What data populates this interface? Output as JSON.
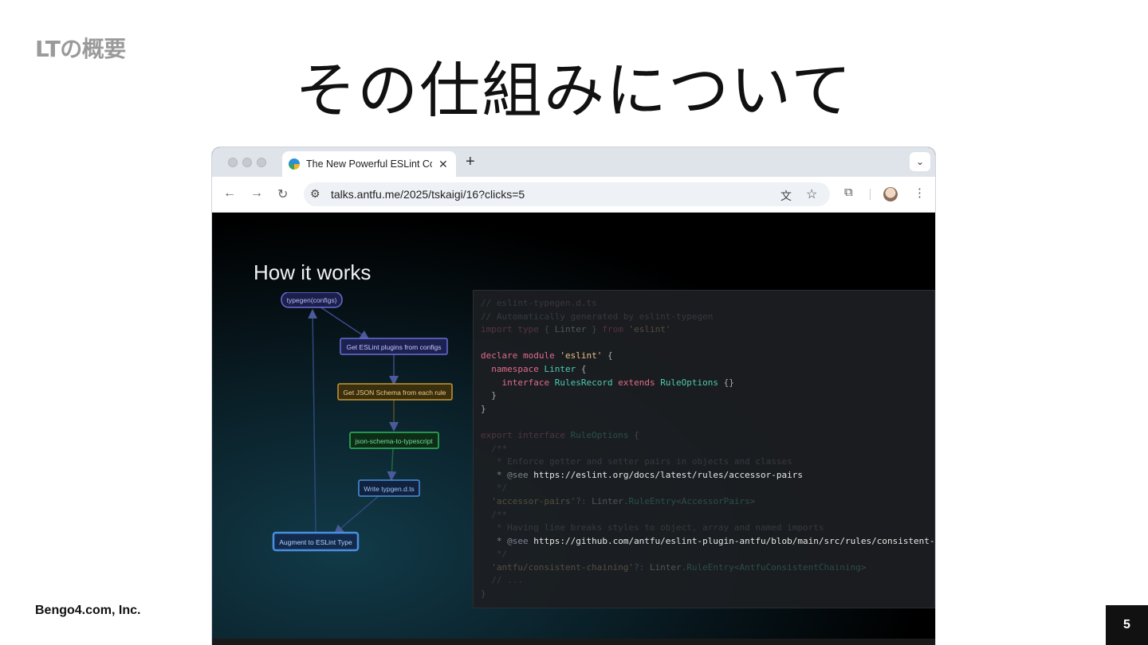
{
  "slide": {
    "section_label": "LTの概要",
    "title": "その仕組みについて",
    "company": "Bengo4.com, Inc.",
    "page_number": "5"
  },
  "browser": {
    "tab_title": "The New Powerful ESLint Con",
    "tab_close": "✕",
    "new_tab": "+",
    "tab_menu": "⌄",
    "back": "←",
    "forward": "→",
    "reload": "↻",
    "site_info": "⚙",
    "url": "talks.antfu.me/2025/tskaigi/16?clicks=5",
    "translate_icon": "文",
    "bookmark_icon": "☆",
    "extensions_icon": "⧉",
    "menu_icon": "⋮"
  },
  "presentation": {
    "heading": "How it works",
    "flow_nodes": [
      {
        "label": "typegen(configs)",
        "color": "#7b7fe0"
      },
      {
        "label": "Get ESLint plugins from configs",
        "color": "#7b7fe0"
      },
      {
        "label": "Get JSON Schema from each rule",
        "color": "#d6a62a"
      },
      {
        "label": "json-schema-to-typescript",
        "color": "#2fb85a"
      },
      {
        "label": "Write typgen.d.ts",
        "color": "#4a8fe0"
      },
      {
        "label": "Augment to ESLint Type",
        "color": "#4a8fe0"
      }
    ],
    "code_lines": [
      {
        "dim": true,
        "tokens": [
          [
            "// eslint-typegen.d.ts",
            "cmt"
          ]
        ]
      },
      {
        "dim": true,
        "tokens": [
          [
            "// Automatically generated by eslint-typegen",
            "cmt"
          ]
        ]
      },
      {
        "dim": true,
        "tokens": [
          [
            "import ",
            "kw"
          ],
          [
            "type ",
            "kw"
          ],
          [
            "{ ",
            "punc"
          ],
          [
            "Linter",
            "txt"
          ],
          [
            " } ",
            "punc"
          ],
          [
            "from ",
            "kw"
          ],
          [
            "'eslint'",
            "str"
          ]
        ]
      },
      {
        "dim": false,
        "tokens": [
          [
            "",
            "txt"
          ]
        ]
      },
      {
        "dim": false,
        "tokens": [
          [
            "declare ",
            "kw"
          ],
          [
            "module ",
            "kw"
          ],
          [
            "'eslint'",
            "str"
          ],
          [
            " {",
            "punc"
          ]
        ]
      },
      {
        "dim": false,
        "tokens": [
          [
            "  namespace ",
            "kw"
          ],
          [
            "Linter",
            "type"
          ],
          [
            " {",
            "punc"
          ]
        ]
      },
      {
        "dim": false,
        "tokens": [
          [
            "    interface ",
            "kw"
          ],
          [
            "RulesRecord ",
            "type"
          ],
          [
            "extends ",
            "kw"
          ],
          [
            "RuleOptions ",
            "type"
          ],
          [
            "{}",
            "punc"
          ]
        ]
      },
      {
        "dim": false,
        "tokens": [
          [
            "  }",
            "punc"
          ]
        ]
      },
      {
        "dim": false,
        "tokens": [
          [
            "}",
            "punc"
          ]
        ]
      },
      {
        "dim": false,
        "tokens": [
          [
            "",
            "txt"
          ]
        ]
      },
      {
        "dim": true,
        "tokens": [
          [
            "export ",
            "kw"
          ],
          [
            "interface ",
            "kw"
          ],
          [
            "RuleOptions ",
            "type"
          ],
          [
            "{",
            "punc"
          ]
        ]
      },
      {
        "dim": true,
        "tokens": [
          [
            "  /**",
            "cmt"
          ]
        ]
      },
      {
        "dim": true,
        "tokens": [
          [
            "   * Enforce getter and setter pairs in objects and classes",
            "cmt"
          ]
        ]
      },
      {
        "dim": false,
        "tokens": [
          [
            "   * @see ",
            "cmt"
          ],
          [
            "https://eslint.org/docs/latest/rules/accessor-pairs",
            "url"
          ]
        ]
      },
      {
        "dim": true,
        "tokens": [
          [
            "   */",
            "cmt"
          ]
        ]
      },
      {
        "dim": true,
        "tokens": [
          [
            "  'accessor-pairs'",
            "str"
          ],
          [
            "?: ",
            "punc"
          ],
          [
            "Linter",
            "txt"
          ],
          [
            ".",
            "punc"
          ],
          [
            "RuleEntry",
            "type"
          ],
          [
            "<",
            "punc"
          ],
          [
            "AccessorPairs",
            "type"
          ],
          [
            ">",
            "punc"
          ]
        ]
      },
      {
        "dim": true,
        "tokens": [
          [
            "  /**",
            "cmt"
          ]
        ]
      },
      {
        "dim": true,
        "tokens": [
          [
            "   * Having line breaks styles to object, array and named imports",
            "cmt"
          ]
        ]
      },
      {
        "dim": false,
        "tokens": [
          [
            "   * @see ",
            "cmt"
          ],
          [
            "https://github.com/antfu/eslint-plugin-antfu/blob/main/src/rules/consistent-",
            "url"
          ]
        ]
      },
      {
        "dim": true,
        "tokens": [
          [
            "   */",
            "cmt"
          ]
        ]
      },
      {
        "dim": true,
        "tokens": [
          [
            "  'antfu/consistent-chaining'",
            "str"
          ],
          [
            "?: ",
            "punc"
          ],
          [
            "Linter",
            "txt"
          ],
          [
            ".",
            "punc"
          ],
          [
            "RuleEntry",
            "type"
          ],
          [
            "<",
            "punc"
          ],
          [
            "AntfuConsistentChaining",
            "type"
          ],
          [
            ">",
            "punc"
          ]
        ]
      },
      {
        "dim": true,
        "tokens": [
          [
            "  // ...",
            "cmt"
          ]
        ]
      },
      {
        "dim": true,
        "tokens": [
          [
            "}",
            "punc"
          ]
        ]
      }
    ]
  }
}
